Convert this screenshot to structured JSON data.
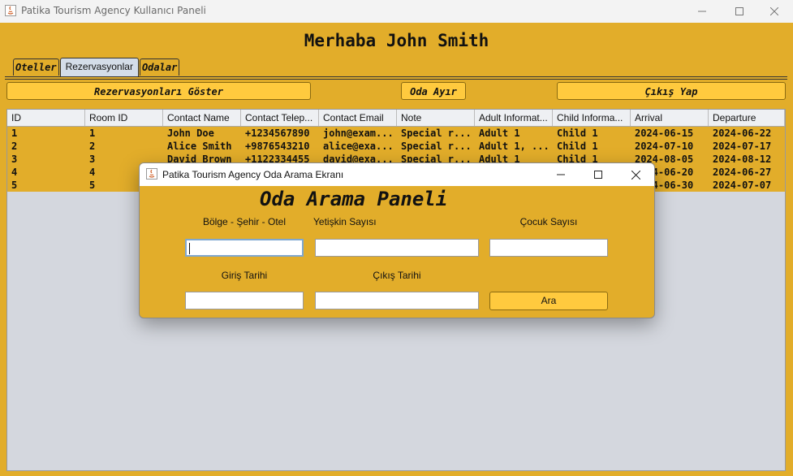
{
  "window": {
    "title": "Patika Tourism Agency Kullanıcı Paneli"
  },
  "greeting": "Merhaba John Smith",
  "tabs": [
    "Oteller",
    "Rezervasyonlar",
    "Odalar"
  ],
  "toolbar": {
    "show_reservations": "Rezervasyonları Göster",
    "book_room": "Oda Ayır",
    "logout": "Çıkış Yap"
  },
  "table": {
    "headers": [
      "ID",
      "Room ID",
      "Contact Name",
      "Contact Telep...",
      "Contact Email",
      "Note",
      "Adult Informat...",
      "Child Informa...",
      "Arrival",
      "Departure"
    ],
    "rows": [
      [
        "1",
        "1",
        "John Doe",
        "+1234567890",
        "john@exam...",
        "Special r...",
        "Adult 1",
        "Child 1",
        "2024-06-15",
        "2024-06-22"
      ],
      [
        "2",
        "2",
        "Alice Smith",
        "+9876543210",
        "alice@exa...",
        "Special r...",
        "Adult 1, ...",
        "Child 1",
        "2024-07-10",
        "2024-07-17"
      ],
      [
        "3",
        "3",
        "David Brown",
        "+1122334455",
        "david@exa...",
        "Special r...",
        "Adult 1",
        "Child 1",
        "2024-08-05",
        "2024-08-12"
      ],
      [
        "4",
        "4",
        "",
        "",
        "",
        "",
        "",
        "",
        "2024-06-20",
        "2024-06-27"
      ],
      [
        "5",
        "5",
        "",
        "",
        "",
        "",
        "",
        "",
        "2024-06-30",
        "2024-07-07"
      ]
    ]
  },
  "dialog": {
    "title": "Patika Tourism Agency Oda Arama Ekranı",
    "panel_title": "Oda Arama Paneli",
    "labels": {
      "region": "Bölge - Şehir - Otel",
      "adults": "Yetişkin Sayısı",
      "children": "Çocuk Sayısı",
      "checkin": "Giriş Tarihi",
      "checkout": "Çıkış Tarihi"
    },
    "search_button": "Ara"
  },
  "colors": {
    "accent": "#e2ad2a",
    "button": "#ffca3e",
    "table_bg": "#d4d7de",
    "focus_border": "#7fa7cf"
  }
}
